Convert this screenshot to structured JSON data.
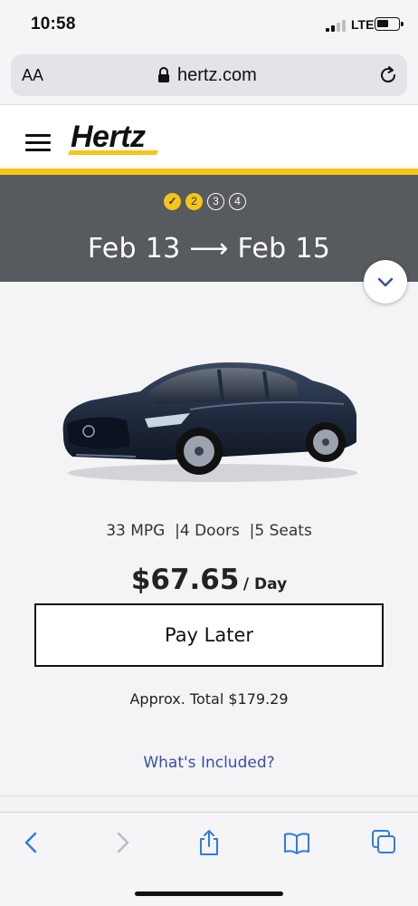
{
  "status_bar": {
    "time": "10:58",
    "network": "LTE"
  },
  "browser": {
    "text_size_label": "AA",
    "url": "hertz.com"
  },
  "site": {
    "logo_text": "Hertz",
    "brand_yellow": "#f5c518",
    "banner_color": "#575a5f"
  },
  "progress": {
    "steps": [
      "✓",
      "2",
      "3",
      "4"
    ],
    "current_step": 2
  },
  "dates": {
    "pickup": "Feb 13",
    "arrow": "⟶",
    "return": "Feb 15"
  },
  "vehicle": {
    "mpg": "33 MPG",
    "doors": "4 Doors",
    "seats": "5 Seats",
    "price": "$67.65",
    "per_day": "/ Day",
    "pay_button": "Pay Later",
    "approx_total": "Approx. Total $179.29",
    "included_link": "What's Included?"
  },
  "toolbar": {
    "icons": [
      "back-icon",
      "forward-icon",
      "share-icon",
      "bookmarks-icon",
      "tabs-icon"
    ],
    "accent": "#2f7ae5"
  }
}
